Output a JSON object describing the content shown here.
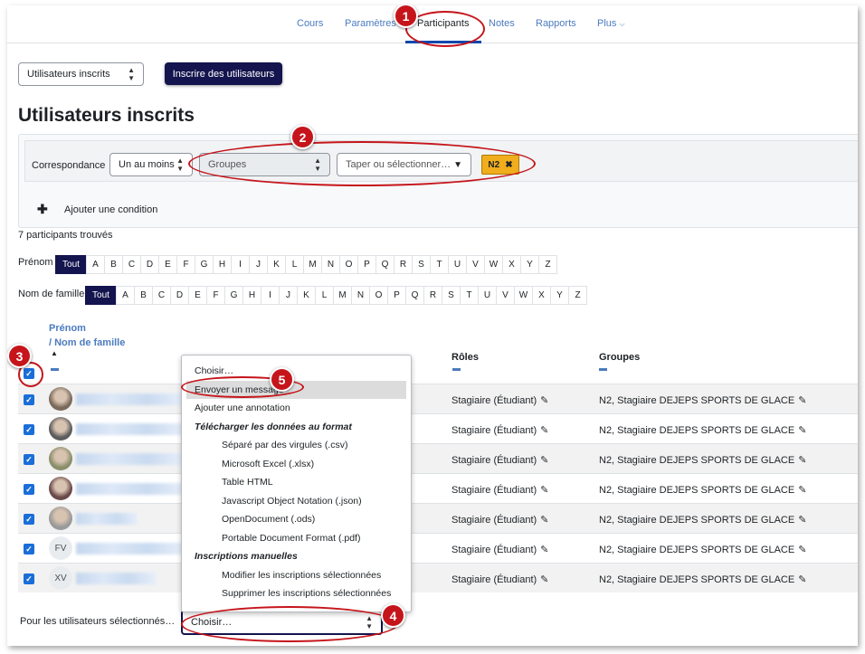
{
  "nav": {
    "tabs": [
      "Cours",
      "Paramètres",
      "Participants",
      "Notes",
      "Rapports",
      "Plus"
    ],
    "active": "Participants",
    "more_chevron": "chevron-down-icon"
  },
  "toolbar": {
    "enrolled_select": "Utilisateurs inscrits",
    "enrol_button": "Inscrire des utilisateurs"
  },
  "page_title": "Utilisateurs inscrits",
  "filter": {
    "match_label": "Correspondance",
    "match_value": "Un au moins",
    "type_value": "Groupes",
    "value_placeholder": "Taper ou sélectionner…",
    "chip": "N2",
    "add_condition": "Ajouter une condition"
  },
  "count": "7 participants trouvés",
  "firstname_filter": {
    "label": "Prénom",
    "letters": [
      "Tout",
      "A",
      "B",
      "C",
      "D",
      "E",
      "F",
      "G",
      "H",
      "I",
      "J",
      "K",
      "L",
      "M",
      "N",
      "O",
      "P",
      "Q",
      "R",
      "S",
      "T",
      "U",
      "V",
      "W",
      "X",
      "Y",
      "Z"
    ]
  },
  "lastname_filter": {
    "label": "Nom de famille",
    "letters": [
      "Tout",
      "A",
      "B",
      "C",
      "D",
      "E",
      "F",
      "G",
      "H",
      "I",
      "J",
      "K",
      "L",
      "M",
      "N",
      "O",
      "P",
      "Q",
      "R",
      "S",
      "T",
      "U",
      "V",
      "W",
      "X",
      "Y",
      "Z"
    ]
  },
  "table": {
    "col_firstname": "Prénom",
    "col_lastname": "/ Nom de famille",
    "sort_indicator": "▲",
    "col_roles": "Rôles",
    "col_groups": "Groupes",
    "rows": [
      {
        "avatar": "photo",
        "initials": "",
        "role": "Stagiaire (Étudiant)",
        "groups": "N2, Stagiaire DEJEPS SPORTS DE GLACE"
      },
      {
        "avatar": "photo",
        "initials": "",
        "role": "Stagiaire (Étudiant)",
        "groups": "N2, Stagiaire DEJEPS SPORTS DE GLACE"
      },
      {
        "avatar": "photo",
        "initials": "",
        "role": "Stagiaire (Étudiant)",
        "groups": "N2, Stagiaire DEJEPS SPORTS DE GLACE"
      },
      {
        "avatar": "photo",
        "initials": "",
        "role": "Stagiaire (Étudiant)",
        "groups": "N2, Stagiaire DEJEPS SPORTS DE GLACE"
      },
      {
        "avatar": "photo",
        "initials": "",
        "role": "Stagiaire (Étudiant)",
        "groups": "N2, Stagiaire DEJEPS SPORTS DE GLACE"
      },
      {
        "avatar": "initials",
        "initials": "FV",
        "role": "Stagiaire (Étudiant)",
        "groups": "N2, Stagiaire DEJEPS SPORTS DE GLACE"
      },
      {
        "avatar": "initials",
        "initials": "XV",
        "role": "Stagiaire (Étudiant)",
        "groups": "N2, Stagiaire DEJEPS SPORTS DE GLACE"
      }
    ]
  },
  "bulk": {
    "label": "Pour les utilisateurs sélectionnés…",
    "select_value": "Choisir…"
  },
  "dropdown": {
    "items": [
      {
        "text": "Choisir…",
        "kind": "option"
      },
      {
        "text": "Envoyer un message",
        "kind": "option",
        "highlighted": true
      },
      {
        "text": "Ajouter une annotation",
        "kind": "option"
      },
      {
        "text": "Télécharger les données au format",
        "kind": "group"
      },
      {
        "text": "Séparé par des virgules (.csv)",
        "kind": "sub"
      },
      {
        "text": "Microsoft Excel (.xlsx)",
        "kind": "sub"
      },
      {
        "text": "Table HTML",
        "kind": "sub"
      },
      {
        "text": "Javascript Object Notation (.json)",
        "kind": "sub"
      },
      {
        "text": "OpenDocument (.ods)",
        "kind": "sub"
      },
      {
        "text": "Portable Document Format (.pdf)",
        "kind": "sub"
      },
      {
        "text": "Inscriptions manuelles",
        "kind": "group"
      },
      {
        "text": "Modifier les inscriptions sélectionnées",
        "kind": "sub"
      },
      {
        "text": "Supprimer les inscriptions sélectionnées",
        "kind": "sub"
      }
    ]
  },
  "callouts": [
    "1",
    "2",
    "3",
    "4",
    "5"
  ],
  "colors": {
    "primary": "#14144e",
    "link": "#4b7bc0",
    "annotation": "#c5151b",
    "chip": "#f0ad1c",
    "checkbox": "#1a6ed8"
  }
}
